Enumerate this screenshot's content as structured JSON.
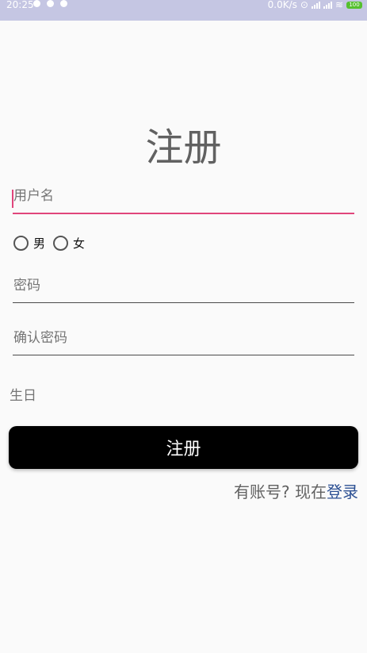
{
  "status_bar": {
    "time": "20:25",
    "network_speed": "0.0K/s",
    "battery_level": "100",
    "battery_color": "#55c02e"
  },
  "form": {
    "title": "注册",
    "username_placeholder": "用户名",
    "gender_options": [
      "男",
      "女"
    ],
    "password_placeholder": "密码",
    "confirm_password_placeholder": "确认密码",
    "birthday_label": "生日",
    "submit_label": "注册",
    "login_prompt": "有账号? 现在",
    "login_link": "登录"
  },
  "colors": {
    "accent": "#e0457b",
    "status_bar": "#c5c6e3",
    "button": "#000000",
    "link": "#2b4f93"
  }
}
